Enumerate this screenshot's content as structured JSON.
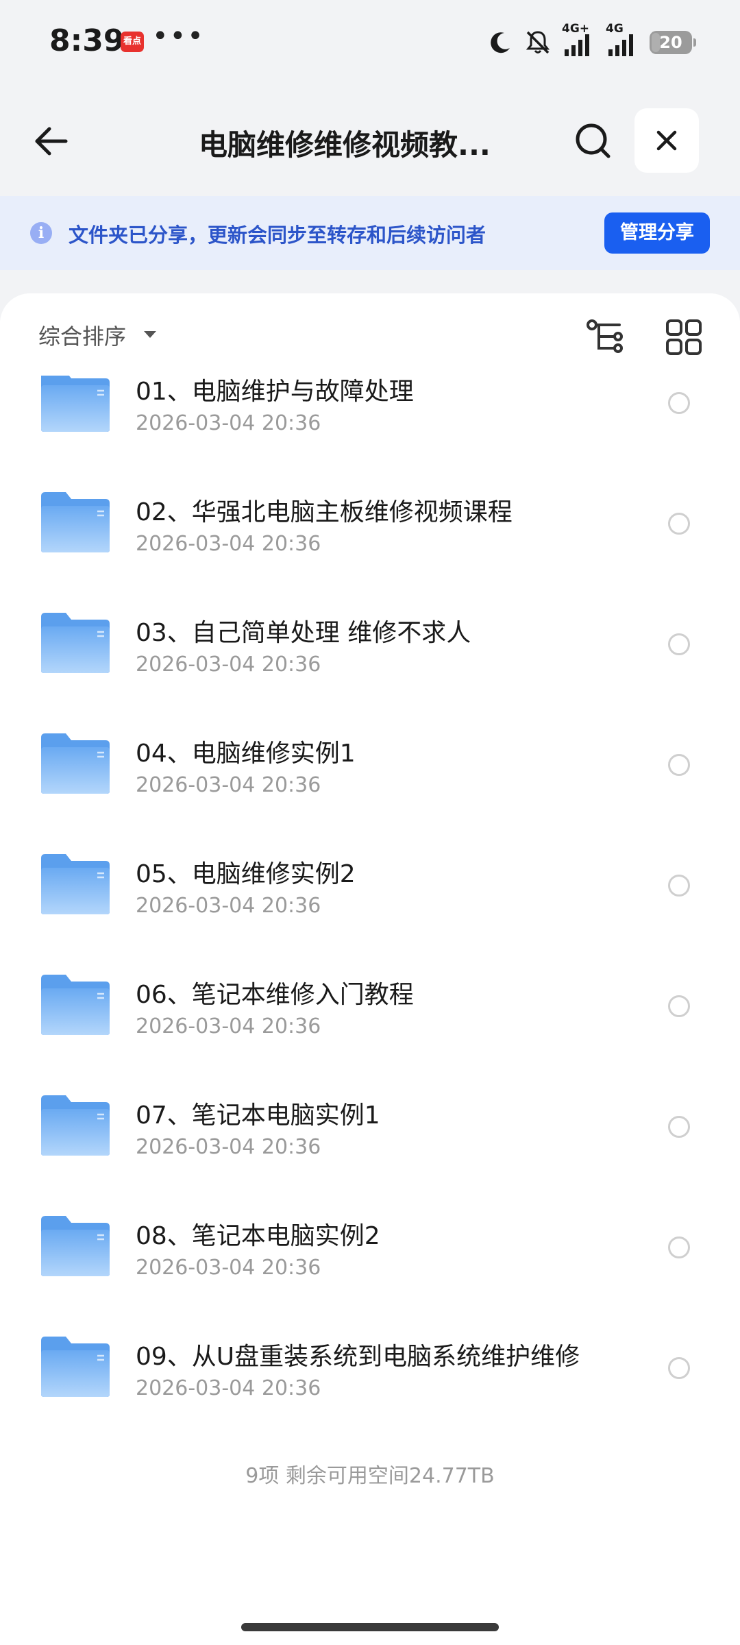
{
  "status_bar": {
    "time": "8:39",
    "app_badge": "看点",
    "more": "•••",
    "signal1_label": "4G+",
    "signal2_label": "4G",
    "battery": "20"
  },
  "header": {
    "title": "电脑维修维修视频教..."
  },
  "banner": {
    "info_icon": "i",
    "text": "文件夹已分享，更新会同步至转存和后续访问者",
    "manage_button": "管理分享"
  },
  "toolbar": {
    "sort_label": "综合排序"
  },
  "files": [
    {
      "name": "01、电脑维护与故障处理",
      "date": "2026-03-04 20:36"
    },
    {
      "name": "02、华强北电脑主板维修视频课程",
      "date": "2026-03-04 20:36"
    },
    {
      "name": "03、自己简单处理 维修不求人",
      "date": "2026-03-04 20:36"
    },
    {
      "name": "04、电脑维修实例1",
      "date": "2026-03-04 20:36"
    },
    {
      "name": "05、电脑维修实例2",
      "date": "2026-03-04 20:36"
    },
    {
      "name": "06、笔记本维修入门教程",
      "date": "2026-03-04 20:36"
    },
    {
      "name": "07、笔记本电脑实例1",
      "date": "2026-03-04 20:36"
    },
    {
      "name": "08、笔记本电脑实例2",
      "date": "2026-03-04 20:36"
    },
    {
      "name": "09、从U盘重装系统到电脑系统维护维修",
      "date": "2026-03-04 20:36"
    }
  ],
  "footer": {
    "summary": "9项 剩余可用空间24.77TB"
  },
  "colors": {
    "accent": "#1a5ff0",
    "banner_bg": "#e8eefb",
    "banner_text": "#2c55c9",
    "folder": "#6fb0f5"
  }
}
